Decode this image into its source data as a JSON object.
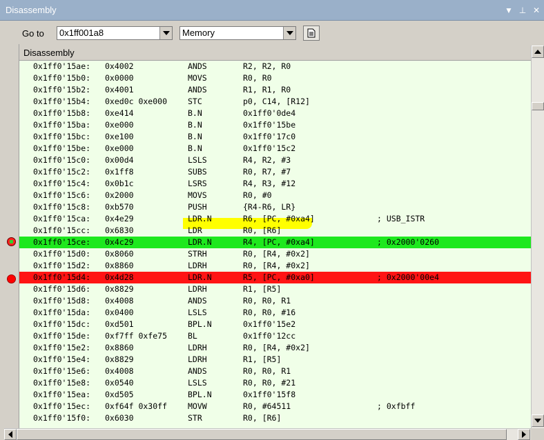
{
  "window": {
    "title": "Disassembly",
    "menu_icon": "triangle-down",
    "pin_icon": "pin",
    "close_icon": "x"
  },
  "toolbar": {
    "goto_label": "Go to",
    "address_value": "0x1ff001a8",
    "view_value": "Memory",
    "doc_icon": "document-icon"
  },
  "listing": {
    "header": "Disassembly",
    "rows": [
      {
        "addr": "0x1ff0'15ae:",
        "code": "0x4002",
        "mn": "ANDS",
        "op": "R2, R2, R0",
        "cm": ""
      },
      {
        "addr": "0x1ff0'15b0:",
        "code": "0x0000",
        "mn": "MOVS",
        "op": "R0, R0",
        "cm": ""
      },
      {
        "addr": "0x1ff0'15b2:",
        "code": "0x4001",
        "mn": "ANDS",
        "op": "R1, R1, R0",
        "cm": ""
      },
      {
        "addr": "0x1ff0'15b4:",
        "code": "0xed0c 0xe000",
        "mn": "STC",
        "op": "p0, C14, [R12]",
        "cm": ""
      },
      {
        "addr": "0x1ff0'15b8:",
        "code": "0xe414",
        "mn": "B.N",
        "op": "0x1ff0'0de4",
        "cm": ""
      },
      {
        "addr": "0x1ff0'15ba:",
        "code": "0xe000",
        "mn": "B.N",
        "op": "0x1ff0'15be",
        "cm": ""
      },
      {
        "addr": "0x1ff0'15bc:",
        "code": "0xe100",
        "mn": "B.N",
        "op": "0x1ff0'17c0",
        "cm": ""
      },
      {
        "addr": "0x1ff0'15be:",
        "code": "0xe000",
        "mn": "B.N",
        "op": "0x1ff0'15c2",
        "cm": ""
      },
      {
        "addr": "0x1ff0'15c0:",
        "code": "0x00d4",
        "mn": "LSLS",
        "op": "R4, R2, #3",
        "cm": ""
      },
      {
        "addr": "0x1ff0'15c2:",
        "code": "0x1ff8",
        "mn": "SUBS",
        "op": "R0, R7, #7",
        "cm": ""
      },
      {
        "addr": "0x1ff0'15c4:",
        "code": "0x0b1c",
        "mn": "LSRS",
        "op": "R4, R3, #12",
        "cm": ""
      },
      {
        "addr": "0x1ff0'15c6:",
        "code": "0x2000",
        "mn": "MOVS",
        "op": "R0, #0",
        "cm": ""
      },
      {
        "addr": "0x1ff0'15c8:",
        "code": "0xb570",
        "mn": "PUSH",
        "op": "{R4-R6, LR}",
        "cm": ""
      },
      {
        "addr": "0x1ff0'15ca:",
        "code": "0x4e29",
        "mn": "LDR.N",
        "op": "R6, [PC, #0xa4]",
        "cm": "; USB_ISTR"
      },
      {
        "addr": "0x1ff0'15cc:",
        "code": "0x6830",
        "mn": "LDR",
        "op": "R0, [R6]",
        "cm": ""
      },
      {
        "addr": "0x1ff0'15ce:",
        "code": "0x4c29",
        "mn": "LDR.N",
        "op": "R4, [PC, #0xa4]",
        "cm": "; 0x2000'0260",
        "hl": "green"
      },
      {
        "addr": "0x1ff0'15d0:",
        "code": "0x8060",
        "mn": "STRH",
        "op": "R0, [R4, #0x2]",
        "cm": ""
      },
      {
        "addr": "0x1ff0'15d2:",
        "code": "0x8860",
        "mn": "LDRH",
        "op": "R0, [R4, #0x2]",
        "cm": ""
      },
      {
        "addr": "0x1ff0'15d4:",
        "code": "0x4d28",
        "mn": "LDR.N",
        "op": "R5, [PC, #0xa0]",
        "cm": "; 0x2000'00e4",
        "hl": "red"
      },
      {
        "addr": "0x1ff0'15d6:",
        "code": "0x8829",
        "mn": "LDRH",
        "op": "R1, [R5]",
        "cm": ""
      },
      {
        "addr": "0x1ff0'15d8:",
        "code": "0x4008",
        "mn": "ANDS",
        "op": "R0, R0, R1",
        "cm": ""
      },
      {
        "addr": "0x1ff0'15da:",
        "code": "0x0400",
        "mn": "LSLS",
        "op": "R0, R0, #16",
        "cm": ""
      },
      {
        "addr": "0x1ff0'15dc:",
        "code": "0xd501",
        "mn": "BPL.N",
        "op": "0x1ff0'15e2",
        "cm": ""
      },
      {
        "addr": "0x1ff0'15de:",
        "code": "0xf7ff 0xfe75",
        "mn": "BL",
        "op": "0x1ff0'12cc",
        "cm": ""
      },
      {
        "addr": "0x1ff0'15e2:",
        "code": "0x8860",
        "mn": "LDRH",
        "op": "R0, [R4, #0x2]",
        "cm": ""
      },
      {
        "addr": "0x1ff0'15e4:",
        "code": "0x8829",
        "mn": "LDRH",
        "op": "R1, [R5]",
        "cm": ""
      },
      {
        "addr": "0x1ff0'15e6:",
        "code": "0x4008",
        "mn": "ANDS",
        "op": "R0, R0, R1",
        "cm": ""
      },
      {
        "addr": "0x1ff0'15e8:",
        "code": "0x0540",
        "mn": "LSLS",
        "op": "R0, R0, #21",
        "cm": ""
      },
      {
        "addr": "0x1ff0'15ea:",
        "code": "0xd505",
        "mn": "BPL.N",
        "op": "0x1ff0'15f8",
        "cm": ""
      },
      {
        "addr": "0x1ff0'15ec:",
        "code": "0xf64f 0x30ff",
        "mn": "MOVW",
        "op": "R0, #64511",
        "cm": "; 0xfbff"
      },
      {
        "addr": "0x1ff0'15f0:",
        "code": "0x6030",
        "mn": "STR",
        "op": "R0, [R6]",
        "cm": ""
      }
    ]
  }
}
